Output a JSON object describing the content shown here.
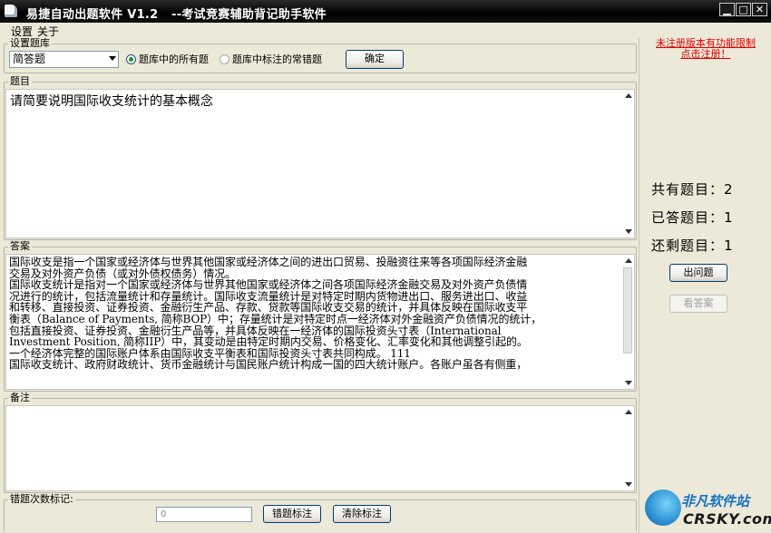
{
  "window": {
    "title": "易捷自动出题软件 V1.2   --考试竞赛辅助背记助手软件",
    "controls": [
      "minimize",
      "maximize",
      "close"
    ]
  },
  "menu": [
    {
      "label": "设置"
    },
    {
      "label": "关于"
    }
  ],
  "settings": {
    "legend": "设置题库",
    "type_selected": "简答题",
    "radio_all": "题库中的所有题",
    "radio_marked": "题库中标注的常错题",
    "confirm_label": "确定"
  },
  "question": {
    "legend": "题目",
    "text": "请简要说明国际收支统计的基本概念"
  },
  "answer": {
    "legend": "答案",
    "lines": [
      "国际收支是指一个国家或经济体与世界其他国家或经济体之间的进出口贸易、投融资往来等各项国际经济金融",
      "交易及对外资产负债（或对外债权债务）情况。",
      "国际收支统计是指对一个国家或经济体与世界其他国家或经济体之间各项国际经济金融交易及对外资产负债情",
      "况进行的统计，包括流量统计和存量统计。国际收支流量统计是对特定时期内货物进出口、服务进出口、收益",
      "和转移、直接投资、证券投资、金融衍生产品、存款、贷款等国际收支交易的统计，并具体反映在国际收支平",
      "衡表（Balance of Payments, 简称BOP）中；存量统计是对特定时点一经济体对外金融资产负债情况的统计，",
      "包括直接投资、证券投资、金融衍生产品等，并具体反映在一经济体的国际投资头寸表（International",
      "Investment Position, 简称IIP）中，其变动是由特定时期内交易、价格变化、汇率变化和其他调整引起的。",
      "一个经济体完整的国际账户体系由国际收支平衡表和国际投资头寸表共同构成。   111",
      "国际收支统计、政府财政统计、货币金融统计与国民账户统计构成一国的四大统计账户。各账户虽各有侧重，"
    ]
  },
  "notes": {
    "legend": "备注",
    "text": ""
  },
  "error_mark": {
    "legend": "错题次数标记:",
    "value": "0",
    "mark_button": "错题标注",
    "clear_button": "清除标注"
  },
  "side": {
    "notice_line1": "未注册版本有功能限制",
    "notice_line2": "点击注册！",
    "total_label": "共有题目：",
    "total_value": "2",
    "answered_label": "已答题目：",
    "answered_value": "1",
    "remaining_label": "还剩题目：",
    "remaining_value": "1",
    "next_button": "出问题",
    "show_answer_button": "看答案"
  },
  "watermark": {
    "text_cn": "非凡软件站",
    "text_en": "CRSKY.com"
  }
}
